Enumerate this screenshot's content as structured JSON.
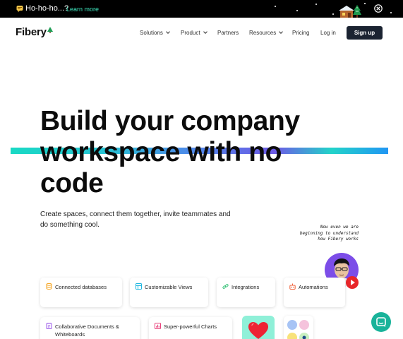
{
  "topbar": {
    "promo_text": "Ho-ho-ho...?",
    "promo_link": "Learn more",
    "icons": [
      "speech-bubble-icon",
      "cabin-icon",
      "close-icon"
    ]
  },
  "nav": {
    "logo": "Fibery",
    "items": [
      {
        "label": "Solutions",
        "dropdown": true
      },
      {
        "label": "Product",
        "dropdown": true
      },
      {
        "label": "Partners",
        "dropdown": false
      },
      {
        "label": "Resources",
        "dropdown": true
      },
      {
        "label": "Pricing",
        "dropdown": false
      },
      {
        "label": "Log in",
        "dropdown": false
      }
    ],
    "signup": "Sign up"
  },
  "hero": {
    "headline_lines": [
      "Build your company",
      "workspace with no",
      "code"
    ],
    "subtitle": "Create spaces, connect them together, invite teammates and do something cool.",
    "note_lines": [
      "Now even we are",
      "beginning to understand",
      "how Fibery works"
    ]
  },
  "features": [
    {
      "label": "Connected databases",
      "icon": "database-icon",
      "color": "#f5a623"
    },
    {
      "label": "Customizable Views",
      "icon": "views-icon",
      "color": "#1fb7e0"
    },
    {
      "label": "Integrations",
      "icon": "link-icon",
      "color": "#3cc47c"
    },
    {
      "label": "Automations",
      "icon": "automation-icon",
      "color": "#f0623a"
    },
    {
      "label": "Collaborative Documents & Whiteboards",
      "icon": "document-icon",
      "color": "#9b59e8"
    },
    {
      "label": "Super-powerful Charts",
      "icon": "chart-icon",
      "color": "#e8407a"
    }
  ],
  "colors": {
    "accent": "#3ee4bd",
    "signup_bg": "#1b2331",
    "chat": "#19b39a",
    "avatar_bg": "#7c4de8"
  }
}
